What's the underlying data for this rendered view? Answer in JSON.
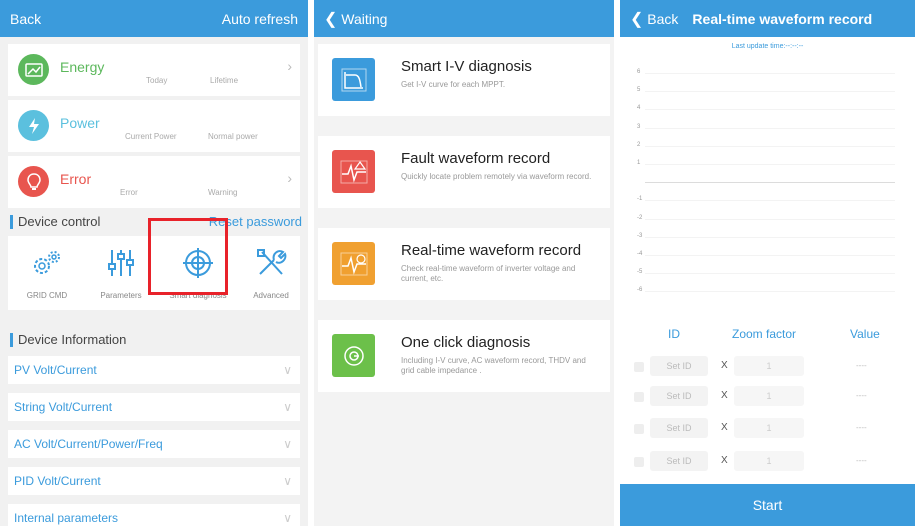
{
  "panel1": {
    "header": {
      "back": "Back",
      "auto_refresh": "Auto refresh"
    },
    "cards": [
      {
        "title": "Energy",
        "sub1": "Today",
        "sub2": "Lifetime",
        "color": "#5cb85c"
      },
      {
        "title": "Power",
        "sub1": "Current Power",
        "sub2": "Normal power",
        "color": "#5bc0de"
      },
      {
        "title": "Error",
        "sub1": "Error",
        "sub2": "Warning",
        "color": "#e8554e"
      }
    ],
    "device_control": {
      "title": "Device control",
      "reset_password": "Reset password",
      "items": [
        {
          "label": "GRID CMD",
          "icon": "gear-cluster-icon"
        },
        {
          "label": "Parameters",
          "icon": "sliders-icon"
        },
        {
          "label": "Smart diagnosis",
          "icon": "target-icon"
        },
        {
          "label": "Advanced",
          "icon": "tools-icon"
        }
      ]
    },
    "device_information": {
      "title": "Device Information",
      "items": [
        "PV Volt/Current",
        "String Volt/Current",
        "AC Volt/Current/Power/Freq",
        "PID Volt/Current",
        "Internal parameters"
      ]
    },
    "accent": "#3b9bdc",
    "highlight_color": "#e8222a"
  },
  "panel2": {
    "header": {
      "back": "Waiting"
    },
    "items": [
      {
        "title": "Smart I-V diagnosis",
        "desc": "Get I-V curve for each MPPT.",
        "color": "#3b9bdc",
        "icon": "iv-curve-icon"
      },
      {
        "title": "Fault waveform record",
        "desc": "Quickly locate problem remotely via waveform record.",
        "color": "#e8554e",
        "icon": "fault-waveform-icon"
      },
      {
        "title": "Real-time waveform record",
        "desc": "Check real-time waveform of inverter voltage and current, etc.",
        "color": "#f0a030",
        "icon": "realtime-waveform-icon"
      },
      {
        "title": "One click diagnosis",
        "desc": "Including I-V curve, AC waveform record, THDV and grid cable impedance .",
        "color": "#6cc04a",
        "icon": "one-click-icon"
      }
    ]
  },
  "panel3": {
    "header": {
      "back": "Back",
      "title": "Real-time waveform record"
    },
    "last_update": "Last update time:--:--:--",
    "y_labels": [
      "6",
      "5",
      "4",
      "3",
      "2",
      "1",
      "",
      "-1",
      "-2",
      "-3",
      "-4",
      "-5",
      "-6"
    ],
    "columns": {
      "id": "ID",
      "zoom": "Zoom factor",
      "value": "Value"
    },
    "rows": [
      {
        "set_id": "Set ID",
        "x": "X",
        "zoom": "1",
        "value": "----"
      },
      {
        "set_id": "Set ID",
        "x": "X",
        "zoom": "1",
        "value": "----"
      },
      {
        "set_id": "Set ID",
        "x": "X",
        "zoom": "1",
        "value": "----"
      },
      {
        "set_id": "Set ID",
        "x": "X",
        "zoom": "1",
        "value": "----"
      }
    ],
    "start": "Start"
  }
}
